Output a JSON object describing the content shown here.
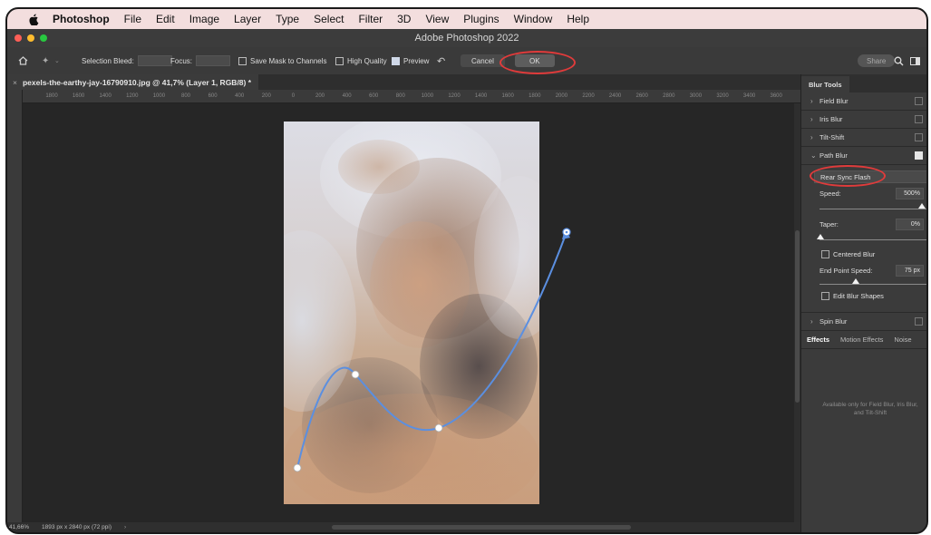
{
  "menubar": {
    "app": "Photoshop",
    "items": [
      "File",
      "Edit",
      "Image",
      "Layer",
      "Type",
      "Select",
      "Filter",
      "3D",
      "View",
      "Plugins",
      "Window",
      "Help"
    ]
  },
  "window_title": "Adobe Photoshop 2022",
  "options": {
    "selection_bleed_label": "Selection Bleed:",
    "focus_label": "Focus:",
    "save_mask_label": "Save Mask to Channels",
    "high_quality_label": "High Quality",
    "preview_label": "Preview",
    "cancel_label": "Cancel",
    "ok_label": "OK",
    "share_label": "Share"
  },
  "document": {
    "tab_title": "pexels-the-earthy-jay-16790910.jpg @ 41,7% (Layer 1, RGB/8) *",
    "ruler_ticks": [
      "1800",
      "1600",
      "1400",
      "1200",
      "1000",
      "800",
      "600",
      "400",
      "200",
      "0",
      "200",
      "400",
      "600",
      "800",
      "1000",
      "1200",
      "1400",
      "1600",
      "1800",
      "2000",
      "2200",
      "2400",
      "2600",
      "2800",
      "3000",
      "3200",
      "3400",
      "3600"
    ],
    "zoom": "41,66%",
    "dimensions": "1893 px x 2840 px (72 ppi)"
  },
  "blur_panel": {
    "title": "Blur Tools",
    "field_blur": "Field Blur",
    "iris_blur": "Iris Blur",
    "tilt_shift": "Tilt-Shift",
    "path_blur": "Path Blur",
    "mode": "Rear Sync Flash",
    "speed_label": "Speed:",
    "speed_value": "500%",
    "taper_label": "Taper:",
    "taper_value": "0%",
    "centered_blur": "Centered Blur",
    "end_point_speed_label": "End Point Speed:",
    "end_point_speed_value": "75 px",
    "edit_blur_shapes": "Edit Blur Shapes",
    "spin_blur": "Spin Blur",
    "tabs": [
      "Effects",
      "Motion Effects",
      "Noise"
    ],
    "note": "Available only for Field Blur, Iris Blur, and Tilt-Shift"
  },
  "colors": {
    "annotation": "#e03b3b",
    "path_blur_line": "#5b8fe0"
  }
}
